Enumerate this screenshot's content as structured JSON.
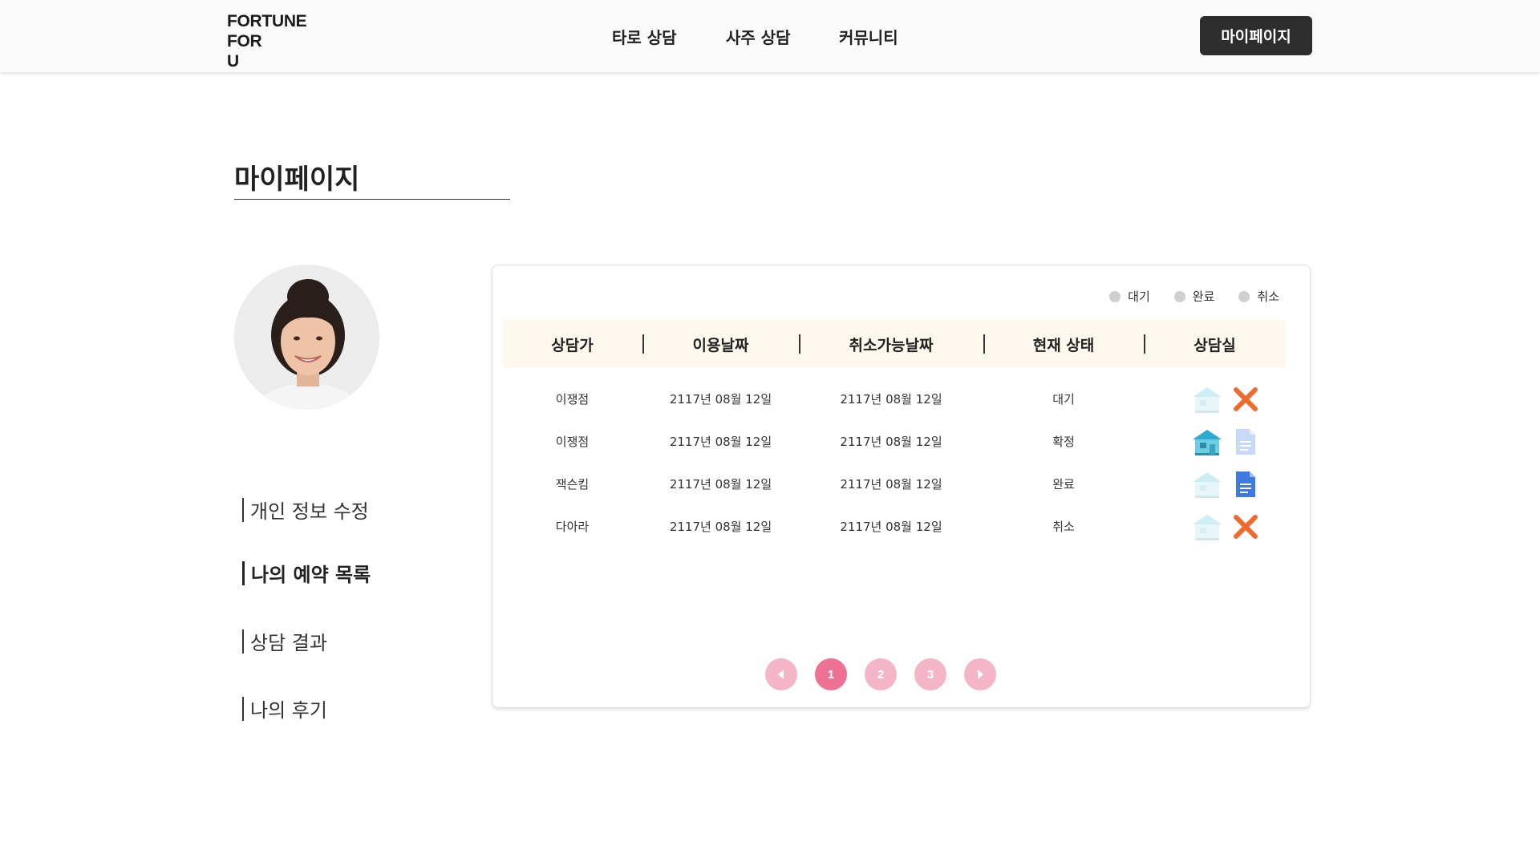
{
  "header": {
    "logo_lines": [
      "FORTUNE",
      "FOR",
      "U"
    ],
    "nav": {
      "tarot": "타로 상담",
      "saju": "사주 상담",
      "community": "커뮤니티"
    },
    "mypage_button": "마이페이지"
  },
  "page": {
    "title": "마이페이지"
  },
  "sidebar": {
    "items": [
      {
        "label": "개인 정보 수정",
        "active": false
      },
      {
        "label": "나의 예약 목록",
        "active": true
      },
      {
        "label": "상담 결과",
        "active": false
      },
      {
        "label": "나의 후기",
        "active": false
      }
    ]
  },
  "legend": {
    "items": [
      "대기",
      "완료",
      "취소"
    ],
    "dot_color": "#cfcfcf"
  },
  "table": {
    "headers": [
      "상담가",
      "이용날짜",
      "취소가능날짜",
      "현재 상태",
      "상담실"
    ],
    "rows": [
      {
        "counselor": "이쟁점",
        "use_date": "2117년 08월 12일",
        "cancel_date": "2117년 08월 12일",
        "status": "대기",
        "room_icon": "house-icon-inactive",
        "action_icon": "x-icon"
      },
      {
        "counselor": "이쟁점",
        "use_date": "2117년 08월 12일",
        "cancel_date": "2117년 08월 12일",
        "status": "확정",
        "room_icon": "house-icon-active",
        "action_icon": "document-icon-inactive"
      },
      {
        "counselor": "잭슨킴",
        "use_date": "2117년 08월 12일",
        "cancel_date": "2117년 08월 12일",
        "status": "완료",
        "room_icon": "house-icon-inactive",
        "action_icon": "document-icon-active"
      },
      {
        "counselor": "다아라",
        "use_date": "2117년 08월 12일",
        "cancel_date": "2117년 08월 12일",
        "status": "취소",
        "room_icon": "house-icon-inactive",
        "action_icon": "x-icon"
      }
    ]
  },
  "pagination": {
    "pages": [
      "1",
      "2",
      "3"
    ],
    "current": "1",
    "active_color": "#ee7296",
    "inactive_color": "#f4b5c6"
  },
  "colors": {
    "header_bg": "#fafafa",
    "button_dark": "#2d2d2d",
    "table_header_bg": "#fdf8ee",
    "x_orange": "#f06a2b",
    "doc_blue": "#3d7be3"
  }
}
